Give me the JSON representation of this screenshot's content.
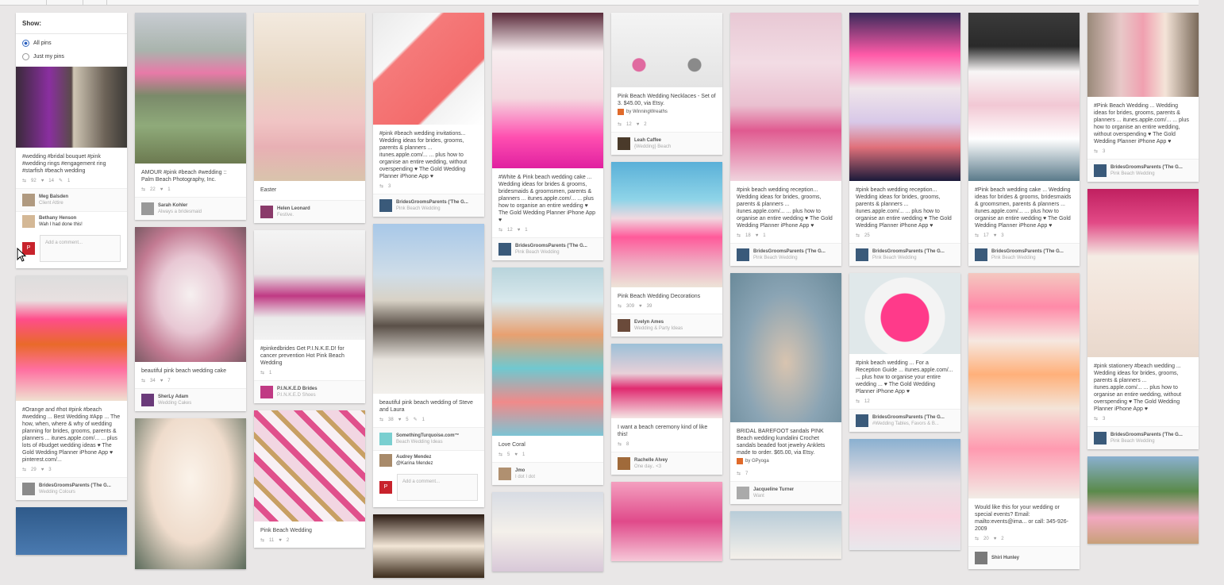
{
  "show_panel": {
    "title": "Show:",
    "options": [
      {
        "label": "All pins",
        "selected": true
      },
      {
        "label": "Just my pins",
        "selected": false
      }
    ]
  },
  "pins": {
    "c1p1": {
      "desc": "#wedding #bridal bouquet #pink #wedding rings #engagement ring #starfish #beach wedding",
      "repins": "92",
      "likes": "14",
      "comments": "1",
      "user": "Meg Balsden",
      "board": "Client Attire",
      "comment_user": "Bethany Henson",
      "comment_text": "Wah I had done this!",
      "add_comment": "Add a comment..."
    },
    "c1p2": {
      "desc": "#Orange and #hot #pink #beach #wedding ... Best Wedding #App ... The how, when, where & why of wedding planning for brides, grooms, parents & planners ... itunes.apple.com/... ... plus lots of #budget wedding ideas ♥ The Gold Wedding Planner iPhone App ♥ pinterest.com/...",
      "repins": "29",
      "likes": "3",
      "user": "BridesGroomsParents ('The G...",
      "board": "Wedding Colours"
    },
    "c2p1": {
      "desc": "AMOUR #pink #beach #wedding :: Palm Beach Photography, Inc.",
      "repins": "22",
      "likes": "1",
      "user": "Sarah Kohler",
      "board": "Always a bridesmaid"
    },
    "c2p2": {
      "desc": "beautiful pink beach wedding cake",
      "repins": "34",
      "likes": "7",
      "user": "SherLy Adam",
      "board": "Wedding Cakes"
    },
    "c3p1": {
      "desc": "Easter",
      "user": "Helen Leonard",
      "board": "Festive."
    },
    "c3p2": {
      "desc": "#pinkedbrides Get P.I.N.K.E.D! for cancer prevention Hot Pink Beach Wedding",
      "repins": "1",
      "user": "P.I.N.K.E.D Brides",
      "board": "P.I.N.K.E.D Shoes"
    },
    "c3p3": {
      "desc": "Pink Beach Wedding",
      "repins": "11",
      "likes": "2"
    },
    "c4p1": {
      "desc": "#pink #beach wedding invitations... Wedding ideas for brides, grooms, parents & planners ... itunes.apple.com/... ... plus how to organise an entire wedding, without overspending ♥ The Gold Wedding Planner iPhone App ♥",
      "repins": "3",
      "user": "BridesGroomsParents ('The G...",
      "board": "Pink Beach Wedding"
    },
    "c4p2": {
      "desc": "beautiful pink beach wedding of Steve and Laura",
      "repins": "38",
      "likes": "5",
      "comments": "1",
      "user": "SomethingTurquoise.com™",
      "board": "Beach Wedding Ideas",
      "comment_user": "Audrey Mendez",
      "comment_text": "@Karina Mendez",
      "add_comment": "Add a comment..."
    },
    "c5p1": {
      "desc": "#White & Pink beach wedding cake ... Wedding ideas for brides & grooms, bridesmaids & groomsmen, parents & planners ... itunes.apple.com/... ... plus how to organise an entire wedding ♥ The Gold Wedding Planner iPhone App ♥",
      "repins": "12",
      "likes": "1",
      "user": "BridesGroomsParents ('The G...",
      "board": "Pink Beach Wedding"
    },
    "c5p2": {
      "desc": "Love Coral",
      "repins": "5",
      "likes": "1",
      "user": "Jmo",
      "board": "I dot I dot"
    },
    "c6p1": {
      "desc": "Pink Beach Wedding Necklaces - Set of 3. $45.00, via Etsy.",
      "source": "by WinningWreaths",
      "repins": "12",
      "likes": "2",
      "user": "Leah Caffee",
      "board": "{Wedding} Beach"
    },
    "c6p2": {
      "desc": "Pink Beach Wedding Decorations",
      "repins": "309",
      "likes": "39",
      "user": "Evelyn Ames",
      "board": "Wedding & Party Ideas"
    },
    "c6p3": {
      "desc": "I want a beach ceremony kind of like this!",
      "repins": "8",
      "user": "Rachelle Alvey",
      "board": "One day.. <3"
    },
    "c7p1": {
      "desc": "#pink beach wedding reception... Wedding ideas for brides, grooms, parents & planners ... itunes.apple.com/... ... plus how to organise an entire wedding ♥ The Gold Wedding Planner iPhone App ♥",
      "repins": "18",
      "likes": "1",
      "user": "BridesGroomsParents ('The G...",
      "board": "Pink Beach Wedding"
    },
    "c7p2": {
      "desc": "BRIDAL BAREFOOT sandals PINK Beach wedding kundalini Crochet sandals beaded foot jewelry Anklets made to order. $65.00, via Etsy.",
      "source": "by GPyoga",
      "repins": "7",
      "user": "Jacqueline Turner",
      "board": "Want"
    },
    "c8p1": {
      "desc": "#pink beach wedding reception... Wedding ideas for brides, grooms, parents & planners ... itunes.apple.com/... ... plus how to organise an entire wedding ♥ The Gold Wedding Planner iPhone App ♥",
      "repins": "25",
      "user": "BridesGroomsParents ('The G...",
      "board": "Pink Beach Wedding"
    },
    "c8p2": {
      "desc": "#pink beach wedding ... For a Reception Guide ... itunes.apple.com/... ... plus how to organise your entire wedding ... ♥ The Gold Wedding Planner iPhone App ♥",
      "repins": "12",
      "user": "BridesGroomsParents ('The G...",
      "board": "#Wedding Tables, Favors & B..."
    },
    "c9p1": {
      "desc": "#Pink beach wedding cake ... Wedding ideas for brides & grooms, bridesmaids & groomsmen, parents & planners ... itunes.apple.com/... ... plus how to organise an entire wedding ♥ The Gold Wedding Planner iPhone App ♥",
      "repins": "17",
      "likes": "3",
      "user": "BridesGroomsParents ('The G...",
      "board": "Pink Beach Wedding"
    },
    "c9p2": {
      "desc": "Would like this for your wedding or special events? Email: mailto:events@ima... or call: 345-926-2009",
      "repins": "20",
      "likes": "2",
      "user": "Shiri Hunley"
    },
    "c10p1": {
      "desc": "#Pink Beach Wedding ... Wedding ideas for brides, grooms, parents & planners ... itunes.apple.com/... ... plus how to organise an entire wedding, without overspending ♥ The Gold Wedding Planner iPhone App ♥",
      "repins": "3",
      "user": "BridesGroomsParents ('The G...",
      "board": "Pink Beach Wedding"
    },
    "c10p2": {
      "desc": "#pink stationery #beach wedding ... Wedding ideas for brides, grooms, parents & planners ... itunes.apple.com/... ... plus how to organise an entire wedding, without overspending ♥ The Gold Wedding Planner iPhone App ♥",
      "repins": "3",
      "user": "BridesGroomsParents ('The G...",
      "board": "Pink Beach Wedding"
    }
  },
  "icons": {
    "repin": "repin-icon",
    "like": "like-icon",
    "comment": "comment-icon",
    "pin_it": "pin-badge-icon",
    "resize": "resize-grip-icon",
    "cursor": "mouse-cursor-icon"
  },
  "colors": {
    "background": "#e9e7e7",
    "card": "#ffffff",
    "accent_red": "#c8232c",
    "muted_text": "#999999"
  }
}
